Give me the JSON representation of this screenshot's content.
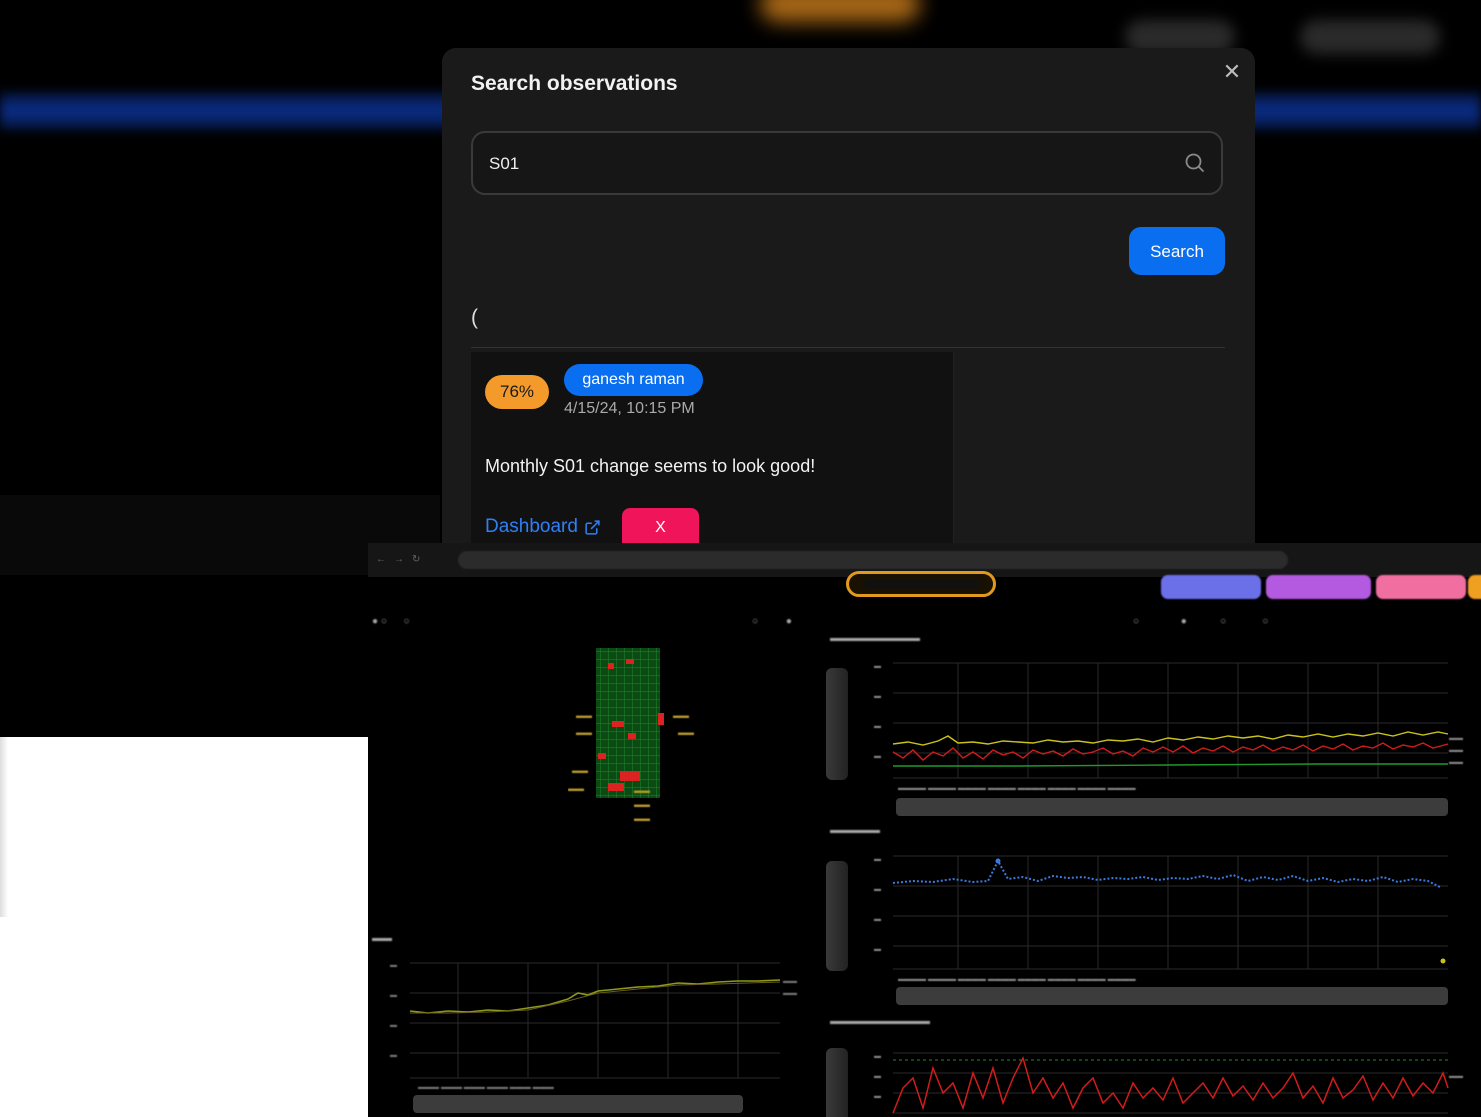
{
  "modal": {
    "title": "Search observations",
    "close_icon": "close-icon",
    "search_value": "S01",
    "search_icon": "search-icon",
    "search_button": "Search",
    "results_paren": "("
  },
  "result_card": {
    "percent": "76%",
    "user": "ganesh raman",
    "timestamp": "4/15/24, 10:15 PM",
    "text": "Monthly S01 change seems to look good!",
    "dashboard_link": "Dashboard",
    "external_icon": "external-link-icon",
    "remove_button": "X"
  },
  "colors": {
    "accent_blue": "#0a6ef0",
    "badge_orange": "#f39a2b",
    "remove_pink": "#f0155a",
    "modal_bg": "#1a1a1b"
  }
}
